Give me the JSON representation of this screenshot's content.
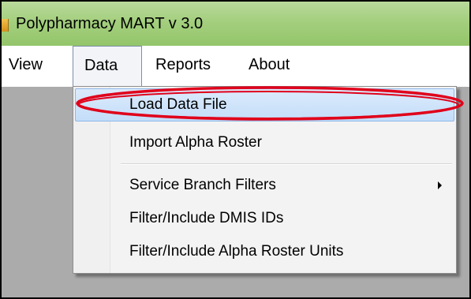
{
  "window": {
    "title": "Polypharmacy MART v 3.0"
  },
  "menubar": {
    "items": [
      {
        "label": "View"
      },
      {
        "label": "Data",
        "active": true
      },
      {
        "label": "Reports"
      },
      {
        "label": "About"
      }
    ]
  },
  "dropdown": {
    "items": [
      {
        "label": "Load Data File",
        "highlighted": true
      },
      {
        "label": "Import Alpha Roster"
      },
      {
        "label": "Service Branch Filters",
        "has_submenu": true
      },
      {
        "label": "Filter/Include DMIS IDs"
      },
      {
        "label": "Filter/Include Alpha Roster Units"
      }
    ]
  },
  "icons": {
    "app": "app-icon",
    "submenu": "submenu-arrow-icon"
  },
  "colors": {
    "titlebar": "#a4cf7e",
    "client_area": "#ababab",
    "menu_highlight": "#c3ddf9",
    "annotation": "#e0001a"
  }
}
